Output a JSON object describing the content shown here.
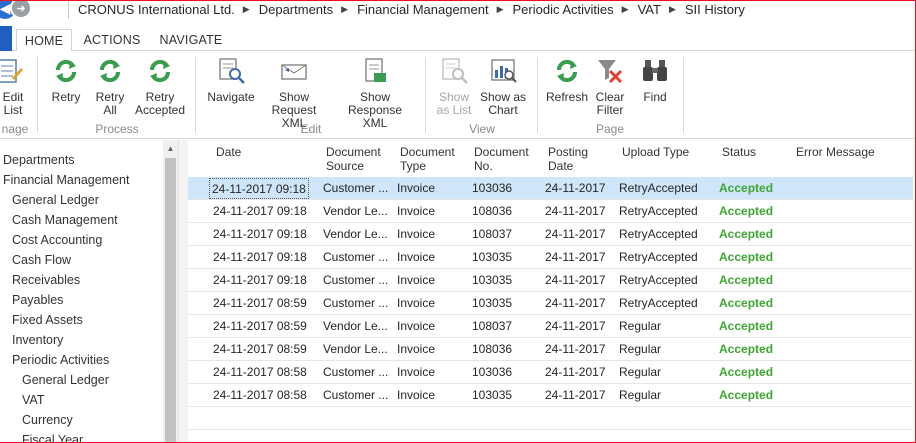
{
  "breadcrumb": [
    "CRONUS International Ltd.",
    "Departments",
    "Financial Management",
    "Periodic Activities",
    "VAT",
    "SII History"
  ],
  "tabs": [
    {
      "label": "HOME",
      "active": true
    },
    {
      "label": "ACTIONS",
      "active": false
    },
    {
      "label": "NAVIGATE",
      "active": false
    }
  ],
  "ribbon": {
    "edit_list": {
      "line1": "Edit",
      "line2": "List"
    },
    "manage_label": "nage",
    "process": {
      "label": "Process",
      "retry": "Retry",
      "retry_all": {
        "line1": "Retry",
        "line2": "All"
      },
      "retry_accepted": {
        "line1": "Retry",
        "line2": "Accepted"
      }
    },
    "edit": {
      "label": "Edit",
      "navigate": "Navigate",
      "show_request": {
        "line1": "Show",
        "line2": "Request XML"
      },
      "show_response": {
        "line1": "Show",
        "line2": "Response XML"
      }
    },
    "view": {
      "label": "View",
      "show_as_list": {
        "line1": "Show",
        "line2": "as List"
      },
      "show_as_chart": {
        "line1": "Show as",
        "line2": "Chart"
      }
    },
    "page": {
      "label": "Page",
      "refresh": "Refresh",
      "clear_filter": {
        "line1": "Clear",
        "line2": "Filter"
      },
      "find": "Find"
    }
  },
  "colors": {
    "accent": "#1e5fc1",
    "status_accepted": "#3fa535",
    "selection": "#cfe5f9",
    "alert_border": "#e81123"
  },
  "nav": {
    "items": [
      "Departments",
      "Financial Management",
      "General Ledger",
      "Cash Management",
      "Cost Accounting",
      "Cash Flow",
      "Receivables",
      "Payables",
      "Fixed Assets",
      "Inventory",
      "Periodic Activities",
      "General Ledger",
      "VAT",
      "Currency",
      "Fiscal Year"
    ]
  },
  "grid": {
    "headers": {
      "date": "Date",
      "doc_source": {
        "line1": "Document",
        "line2": "Source"
      },
      "doc_type": {
        "line1": "Document",
        "line2": "Type"
      },
      "doc_no": {
        "line1": "Document",
        "line2": "No."
      },
      "posting_date": {
        "line1": "Posting",
        "line2": "Date"
      },
      "upload_type": "Upload Type",
      "status": "Status",
      "error_message": "Error Message"
    },
    "rows": [
      {
        "date": "24-11-2017 09:18",
        "source": "Customer ...",
        "type": "Invoice",
        "no": "103036",
        "posting": "24-11-2017",
        "upload": "RetryAccepted",
        "status": "Accepted",
        "error": "",
        "selected": true
      },
      {
        "date": "24-11-2017 09:18",
        "source": "Vendor Le...",
        "type": "Invoice",
        "no": "108036",
        "posting": "24-11-2017",
        "upload": "RetryAccepted",
        "status": "Accepted",
        "error": ""
      },
      {
        "date": "24-11-2017 09:18",
        "source": "Vendor Le...",
        "type": "Invoice",
        "no": "108037",
        "posting": "24-11-2017",
        "upload": "RetryAccepted",
        "status": "Accepted",
        "error": ""
      },
      {
        "date": "24-11-2017 09:18",
        "source": "Customer ...",
        "type": "Invoice",
        "no": "103035",
        "posting": "24-11-2017",
        "upload": "RetryAccepted",
        "status": "Accepted",
        "error": ""
      },
      {
        "date": "24-11-2017 09:18",
        "source": "Customer ...",
        "type": "Invoice",
        "no": "103035",
        "posting": "24-11-2017",
        "upload": "RetryAccepted",
        "status": "Accepted",
        "error": ""
      },
      {
        "date": "24-11-2017 08:59",
        "source": "Customer ...",
        "type": "Invoice",
        "no": "103035",
        "posting": "24-11-2017",
        "upload": "RetryAccepted",
        "status": "Accepted",
        "error": ""
      },
      {
        "date": "24-11-2017 08:59",
        "source": "Vendor Le...",
        "type": "Invoice",
        "no": "108037",
        "posting": "24-11-2017",
        "upload": "Regular",
        "status": "Accepted",
        "error": ""
      },
      {
        "date": "24-11-2017 08:59",
        "source": "Vendor Le...",
        "type": "Invoice",
        "no": "108036",
        "posting": "24-11-2017",
        "upload": "Regular",
        "status": "Accepted",
        "error": ""
      },
      {
        "date": "24-11-2017 08:58",
        "source": "Customer ...",
        "type": "Invoice",
        "no": "103036",
        "posting": "24-11-2017",
        "upload": "Regular",
        "status": "Accepted",
        "error": ""
      },
      {
        "date": "24-11-2017 08:58",
        "source": "Customer ...",
        "type": "Invoice",
        "no": "103035",
        "posting": "24-11-2017",
        "upload": "Regular",
        "status": "Accepted",
        "error": ""
      }
    ]
  }
}
